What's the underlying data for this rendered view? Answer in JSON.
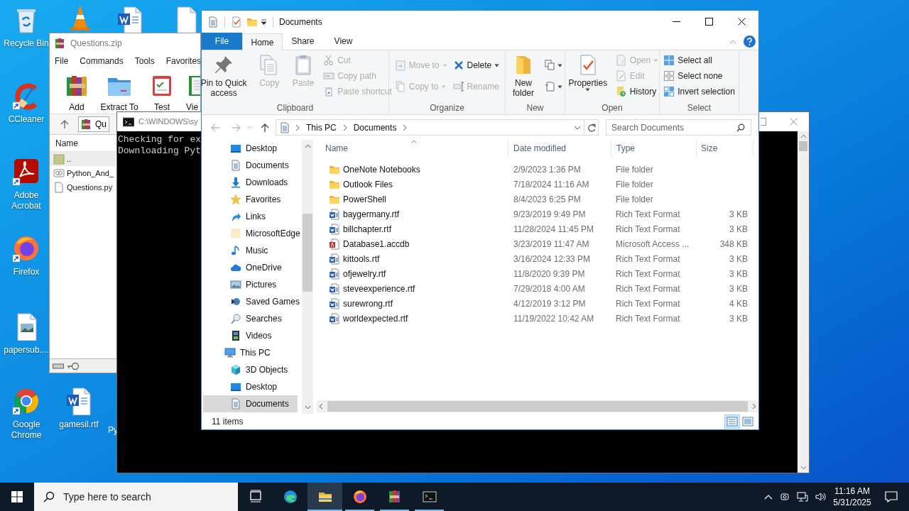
{
  "desktop": {
    "icons": [
      {
        "kind": "recycle",
        "label": "Recycle Bin"
      },
      {
        "kind": "cone"
      },
      {
        "kind": "word"
      },
      {
        "kind": "blank"
      },
      {
        "kind": "ccleaner",
        "label": "CCleaner"
      },
      {
        "kind": "acrobat",
        "label": "Adobe Acrobat"
      },
      {
        "kind": "firefox",
        "label": "Firefox"
      },
      {
        "kind": "image",
        "label": "papersub...."
      },
      {
        "kind": "chrome",
        "label": "Google Chrome"
      },
      {
        "kind": "word",
        "label": "gamesil.rtf"
      },
      {
        "kind": "hidden",
        "label": "Py"
      }
    ]
  },
  "archiver": {
    "title": "Questions.zip",
    "menu": [
      "File",
      "Commands",
      "Tools",
      "Favorites"
    ],
    "toolbar": [
      "Add",
      "Extract To",
      "Test",
      "Vie"
    ],
    "address": "Qu",
    "column": "Name",
    "files": [
      {
        "name": "..",
        "kind": "up",
        "selected": true
      },
      {
        "name": "Python_And_",
        "kind": "zip",
        "selected": false
      },
      {
        "name": "Questions.py",
        "kind": "file",
        "selected": false
      }
    ]
  },
  "console": {
    "title": "C:\\WINDOWS\\sy",
    "lines": [
      "Checking for ex",
      "Downloading Pyt"
    ]
  },
  "explorer": {
    "title": "Documents",
    "tabs": [
      {
        "label": "File",
        "kind": "menu",
        "selected": false
      },
      {
        "label": "Home",
        "kind": "tab",
        "selected": true
      },
      {
        "label": "Share",
        "kind": "tab",
        "selected": false
      },
      {
        "label": "View",
        "kind": "tab",
        "selected": false
      }
    ],
    "ribbon": [
      {
        "label": "Clipboard",
        "columns": [
          {
            "kind": "large",
            "items": [
              {
                "label": "Pin to Quick access",
                "disabled": false
              }
            ]
          },
          {
            "kind": "large",
            "items": [
              {
                "label": "Copy",
                "disabled": true
              }
            ]
          },
          {
            "kind": "large",
            "items": [
              {
                "label": "Paste",
                "disabled": true
              }
            ]
          },
          {
            "kind": "small",
            "items": [
              {
                "label": "Cut",
                "disabled": true
              },
              {
                "label": "Copy path",
                "disabled": true
              },
              {
                "label": "Paste shortcut",
                "disabled": true
              }
            ]
          }
        ]
      },
      {
        "label": "Organize",
        "columns": [
          {
            "kind": "small",
            "items": [
              {
                "label": "Move to",
                "disabled": true,
                "dropdown": true
              },
              {
                "label": "Copy to",
                "disabled": true,
                "dropdown": true
              }
            ]
          },
          {
            "kind": "small",
            "items": [
              {
                "label": "Delete",
                "disabled": false,
                "dropdown": true
              },
              {
                "label": "Rename",
                "disabled": true
              }
            ]
          }
        ]
      },
      {
        "label": "New",
        "columns": [
          {
            "kind": "large",
            "items": [
              {
                "label": "New folder",
                "disabled": false
              }
            ]
          },
          {
            "kind": "icon",
            "items": [
              {
                "disabled": false,
                "dropdown": true
              },
              {
                "disabled": false,
                "dropdown": true
              }
            ]
          }
        ]
      },
      {
        "label": "Open",
        "columns": [
          {
            "kind": "large",
            "items": [
              {
                "label": "Properties",
                "disabled": false,
                "dropdown": true
              }
            ]
          },
          {
            "kind": "small",
            "items": [
              {
                "label": "Open",
                "disabled": true,
                "dropdown": true
              },
              {
                "label": "Edit",
                "disabled": true
              },
              {
                "label": "History",
                "disabled": false
              }
            ]
          }
        ]
      },
      {
        "label": "Select",
        "columns": [
          {
            "kind": "small",
            "items": [
              {
                "label": "Select all",
                "disabled": false
              },
              {
                "label": "Select none",
                "disabled": false
              },
              {
                "label": "Invert selection",
                "disabled": false
              }
            ]
          }
        ]
      }
    ],
    "address": {
      "crumbs": [
        "This PC",
        "Documents"
      ]
    },
    "search": {
      "placeholder": "Search Documents"
    },
    "navigation": {
      "quick_access": [
        {
          "label": "Desktop",
          "selected": false
        },
        {
          "label": "Documents",
          "selected": false
        },
        {
          "label": "Downloads",
          "selected": false
        },
        {
          "label": "Favorites",
          "selected": false
        },
        {
          "label": "Links",
          "selected": false
        },
        {
          "label": "MicrosoftEdge",
          "selected": false
        },
        {
          "label": "Music",
          "selected": false
        },
        {
          "label": "OneDrive",
          "selected": false
        },
        {
          "label": "Pictures",
          "selected": false
        },
        {
          "label": "Saved Games",
          "selected": false
        },
        {
          "label": "Searches",
          "selected": false
        },
        {
          "label": "Videos",
          "selected": false
        }
      ],
      "this_pc": {
        "label": "This PC",
        "selected": false,
        "children": [
          {
            "label": "3D Objects",
            "selected": false
          },
          {
            "label": "Desktop",
            "selected": false
          },
          {
            "label": "Documents",
            "selected": true
          }
        ]
      }
    },
    "columns": [
      {
        "label": "Name",
        "sorted": true
      },
      {
        "label": "Date modified",
        "sorted": false
      },
      {
        "label": "Type",
        "sorted": false
      },
      {
        "label": "Size",
        "sorted": false
      }
    ],
    "rows": [
      {
        "name": "OneNote Notebooks",
        "date": "2/9/2023 1:36 PM",
        "type": "File folder",
        "kind": "folder"
      },
      {
        "name": "Outlook Files",
        "date": "7/18/2024 11:16 AM",
        "type": "File folder",
        "kind": "folder"
      },
      {
        "name": "PowerShell",
        "date": "8/4/2023 6:25 PM",
        "type": "File folder",
        "kind": "folder"
      },
      {
        "name": "baygermany.rtf",
        "date": "9/23/2019 9:49 PM",
        "type": "Rich Text Format",
        "size": "3 KB",
        "kind": "word"
      },
      {
        "name": "billchapter.rtf",
        "date": "11/28/2024 11:45 PM",
        "type": "Rich Text Format",
        "size": "3 KB",
        "kind": "word"
      },
      {
        "name": "Database1.accdb",
        "date": "3/23/2019 11:47 AM",
        "type": "Microsoft Access ...",
        "size": "348 KB",
        "kind": "access"
      },
      {
        "name": "kittools.rtf",
        "date": "3/16/2024 12:33 PM",
        "type": "Rich Text Format",
        "size": "3 KB",
        "kind": "word"
      },
      {
        "name": "ofjewelry.rtf",
        "date": "11/8/2020 9:39 PM",
        "type": "Rich Text Format",
        "size": "3 KB",
        "kind": "word"
      },
      {
        "name": "steveexperience.rtf",
        "date": "7/29/2018 4:00 AM",
        "type": "Rich Text Format",
        "size": "3 KB",
        "kind": "word"
      },
      {
        "name": "surewrong.rtf",
        "date": "4/12/2019 3:12 PM",
        "type": "Rich Text Format",
        "size": "4 KB",
        "kind": "word"
      },
      {
        "name": "worldexpected.rtf",
        "date": "11/19/2022 10:42 AM",
        "type": "Rich Text Format",
        "size": "3 KB",
        "kind": "word"
      }
    ],
    "status": "11 items",
    "views": [
      {
        "kind": "details",
        "selected": true
      },
      {
        "kind": "tiles",
        "selected": false
      }
    ]
  },
  "taskbar": {
    "search": {
      "placeholder": "Type here to search"
    },
    "apps": [
      {
        "kind": "taskview",
        "running": false,
        "selected": false
      },
      {
        "kind": "edge",
        "running": false,
        "selected": false
      },
      {
        "kind": "explorer",
        "running": true,
        "selected": true
      },
      {
        "kind": "firefox",
        "running": true,
        "selected": false
      },
      {
        "kind": "winrar",
        "running": true,
        "selected": false
      },
      {
        "kind": "terminal",
        "running": true,
        "selected": false
      }
    ],
    "time": "11:16 AM",
    "date": "5/31/2025"
  }
}
